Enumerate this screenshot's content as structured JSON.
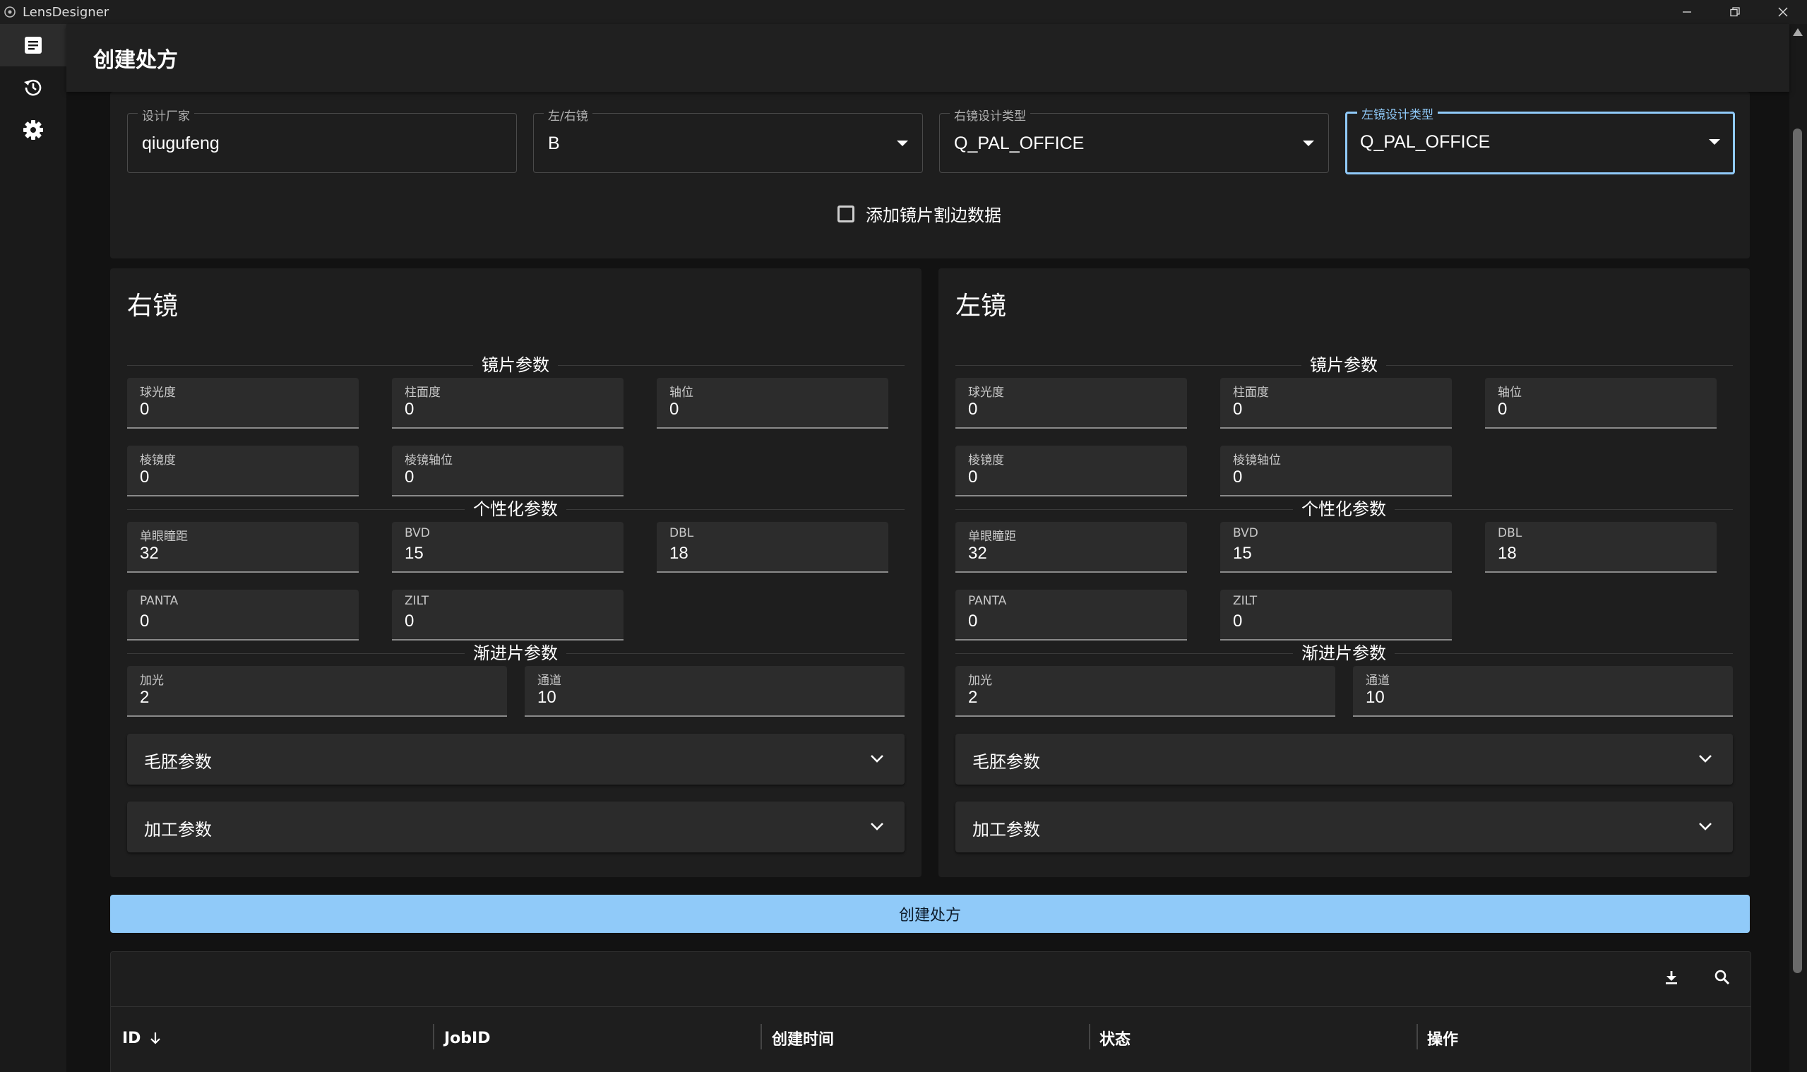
{
  "window": {
    "title": "LensDesigner"
  },
  "header": {
    "title": "创建处方"
  },
  "form": {
    "manufacturer": {
      "label": "设计厂家",
      "value": "qiugufeng"
    },
    "eye_side": {
      "label": "左/右镜",
      "value": "B"
    },
    "right_design_type": {
      "label": "右镜设计类型",
      "value": "Q_PAL_OFFICE"
    },
    "left_design_type": {
      "label": "左镜设计类型",
      "value": "Q_PAL_OFFICE"
    },
    "edging_checkbox": {
      "label": "添加镜片割边数据",
      "checked": false
    }
  },
  "right_lens": {
    "title": "右镜",
    "sections": {
      "lens_params": "镜片参数",
      "personal_params": "个性化参数",
      "progressive_params": "渐进片参数"
    },
    "sphere": {
      "label": "球光度",
      "value": "0"
    },
    "cylinder": {
      "label": "柱面度",
      "value": "0"
    },
    "axis": {
      "label": "轴位",
      "value": "0"
    },
    "prism": {
      "label": "棱镜度",
      "value": "0"
    },
    "prism_axis": {
      "label": "棱镜轴位",
      "value": "0"
    },
    "pd": {
      "label": "单眼瞳距",
      "value": "32"
    },
    "bvd": {
      "label": "BVD",
      "value": "15"
    },
    "dbl": {
      "label": "DBL",
      "value": "18"
    },
    "panta": {
      "label": "PANTA",
      "value": "0"
    },
    "zilt": {
      "label": "ZILT",
      "value": "0"
    },
    "add": {
      "label": "加光",
      "value": "2"
    },
    "corridor": {
      "label": "通道",
      "value": "10"
    },
    "blank_params": "毛胚参数",
    "processing_params": "加工参数"
  },
  "left_lens": {
    "title": "左镜",
    "sections": {
      "lens_params": "镜片参数",
      "personal_params": "个性化参数",
      "progressive_params": "渐进片参数"
    },
    "sphere": {
      "label": "球光度",
      "value": "0"
    },
    "cylinder": {
      "label": "柱面度",
      "value": "0"
    },
    "axis": {
      "label": "轴位",
      "value": "0"
    },
    "prism": {
      "label": "棱镜度",
      "value": "0"
    },
    "prism_axis": {
      "label": "棱镜轴位",
      "value": "0"
    },
    "pd": {
      "label": "单眼瞳距",
      "value": "32"
    },
    "bvd": {
      "label": "BVD",
      "value": "15"
    },
    "dbl": {
      "label": "DBL",
      "value": "18"
    },
    "panta": {
      "label": "PANTA",
      "value": "0"
    },
    "zilt": {
      "label": "ZILT",
      "value": "0"
    },
    "add": {
      "label": "加光",
      "value": "2"
    },
    "corridor": {
      "label": "通道",
      "value": "10"
    },
    "blank_params": "毛胚参数",
    "processing_params": "加工参数"
  },
  "actions": {
    "create_label": "创建处方"
  },
  "table": {
    "columns": [
      "ID",
      "JobID",
      "创建时间",
      "状态",
      "操作"
    ],
    "sort_column": "ID",
    "sort_direction": "desc"
  },
  "colors": {
    "accent": "#90caf9",
    "background": "#121212",
    "surface": "#1e1e1e",
    "field": "#2c2c2c"
  }
}
